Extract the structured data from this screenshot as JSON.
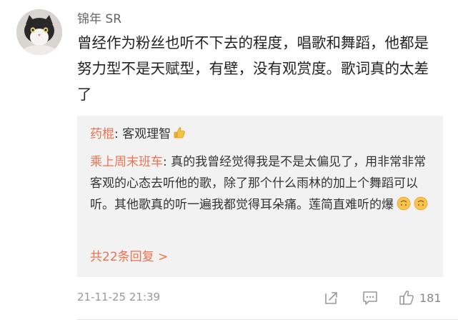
{
  "post": {
    "author": "锦年 SR",
    "text": "曾经作为粉丝也听不下去的程度，唱歌和舞蹈，他都是努力型不是天赋型，有壁，没有观赏度。歌词真的太差了",
    "timestamp": "21-11-25 21:39",
    "like_count": "181"
  },
  "replies": [
    {
      "author": "药棍",
      "separator": ": ",
      "text": "客观理智",
      "emoji": [
        "thumbs-up"
      ]
    },
    {
      "author": "乘上周末班车",
      "separator": ": ",
      "text": "真的我曾经觉得我是不是太偏见了，用非常非常客观的心态去听他的歌，除了那个什么雨林的加上个舞蹈可以听。其他歌真的听一遍我都觉得耳朵痛。莲简直难听的爆",
      "emoji": [
        "upside-down-face",
        "upside-down-face"
      ]
    }
  ],
  "more_replies": "共22条回复 >",
  "icons": {
    "avatar": "cat-photo-avatar",
    "share": "share-icon",
    "comment": "comment-icon",
    "like": "thumbs-up-icon"
  },
  "colors": {
    "link": "#eb7350",
    "reply_background": "#f2f2f2",
    "text": "#222222",
    "meta": "#999999"
  }
}
